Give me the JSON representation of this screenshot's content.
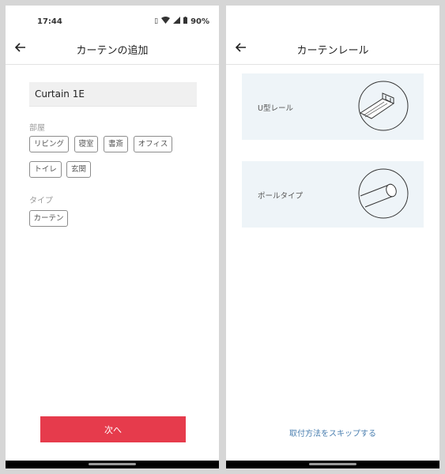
{
  "status_bar": {
    "time": "17:44",
    "battery": "90%"
  },
  "left_screen": {
    "title": "カーテンの追加",
    "name_value": "Curtain 1E",
    "room_label": "部屋",
    "rooms": [
      "リビング",
      "寝室",
      "書斎",
      "オフィス",
      "トイレ",
      "玄関"
    ],
    "type_label": "タイプ",
    "types": [
      "カーテン"
    ],
    "next_button": "次へ"
  },
  "right_screen": {
    "title": "カーテンレール",
    "options": [
      {
        "label": "U型レール",
        "icon": "u-rail-icon"
      },
      {
        "label": "ポールタイプ",
        "icon": "pole-rail-icon"
      }
    ],
    "skip_link": "取付方法をスキップする"
  }
}
